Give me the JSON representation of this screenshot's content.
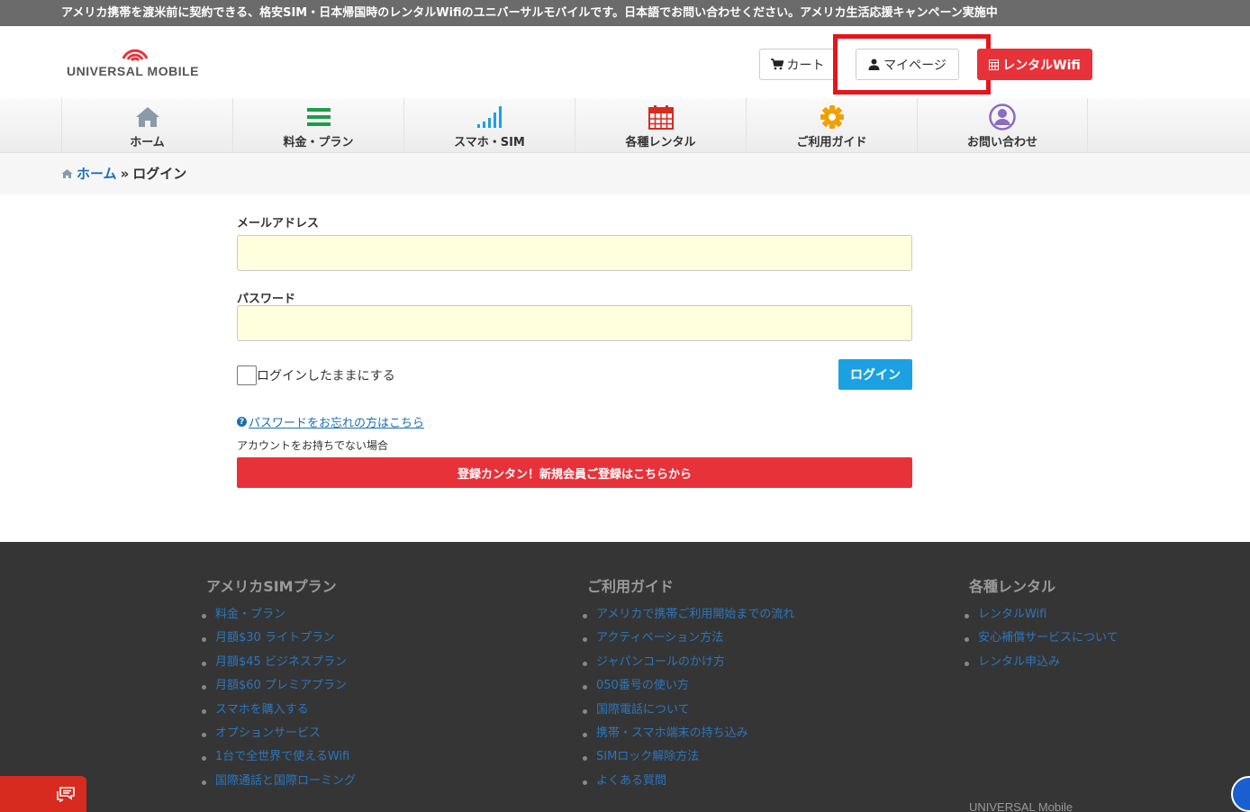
{
  "topbar": {
    "text": "アメリカ携帯を渡米前に契約できる、格安SIM・日本帰国時のレンタルWifiのユニバーサルモバイルです。日本語でお問い合わせください。アメリカ生活応援キャンペーン実施中"
  },
  "header": {
    "logo_text": "UNIVERSAL MOBILE",
    "cart_label": "カート",
    "mypage_label": "マイページ",
    "rental_label": "レンタルWifi"
  },
  "nav": {
    "items": [
      {
        "label": "ホーム",
        "icon": "home-icon",
        "color": "#8a9aa8"
      },
      {
        "label": "料金・プラン",
        "icon": "list-icon",
        "color": "#1e9c4a"
      },
      {
        "label": "スマホ・SIM",
        "icon": "signal-icon",
        "color": "#1ba1e2"
      },
      {
        "label": "各種レンタル",
        "icon": "calendar-icon",
        "color": "#d62b1e"
      },
      {
        "label": "ご利用ガイド",
        "icon": "gear-icon",
        "color": "#f0a000"
      },
      {
        "label": "お問い合わせ",
        "icon": "user-circle-icon",
        "color": "#8c6bc0"
      }
    ]
  },
  "breadcrumb": {
    "home": "ホーム",
    "separator": "»",
    "current": "ログイン"
  },
  "form": {
    "email_label": "メールアドレス",
    "email_value": "",
    "password_label": "パスワード",
    "password_value": "",
    "remember_label": "ログインしたままにする",
    "login_button": "ログイン",
    "forgot_link": "パスワードをお忘れの方はこちら",
    "no_account_text": "アカウントをお持ちでない場合",
    "register_button": "登録カンタン！新規会員ご登録はこちらから"
  },
  "footer": {
    "columns": [
      {
        "title": "アメリカSIMプラン",
        "links": [
          "料金・プラン",
          "月額$30 ライトプラン",
          "月額$45 ビジネスプラン",
          "月額$60 プレミアプラン",
          "スマホを購入する",
          "オプションサービス",
          "1台で全世界で使えるWifi",
          "国際通話と国際ローミング"
        ]
      },
      {
        "title": "ご利用ガイド",
        "links": [
          "アメリカで携帯ご利用開始までの流れ",
          "アクティベーション方法",
          "ジャパンコールのかけ方",
          "050番号の使い方",
          "国際電話について",
          "携帯・スマホ端末の持ち込み",
          "SIMロック解除方法",
          "よくある質問"
        ]
      },
      {
        "title": "各種レンタル",
        "links": [
          "レンタルWifi",
          "安心補償サービスについて",
          "レンタル申込み"
        ]
      }
    ],
    "brand": "UNIVERSAL Mobile"
  },
  "colors": {
    "accent_red": "#e8323a",
    "accent_blue": "#1ba1e2",
    "highlight": "#e8141c"
  }
}
